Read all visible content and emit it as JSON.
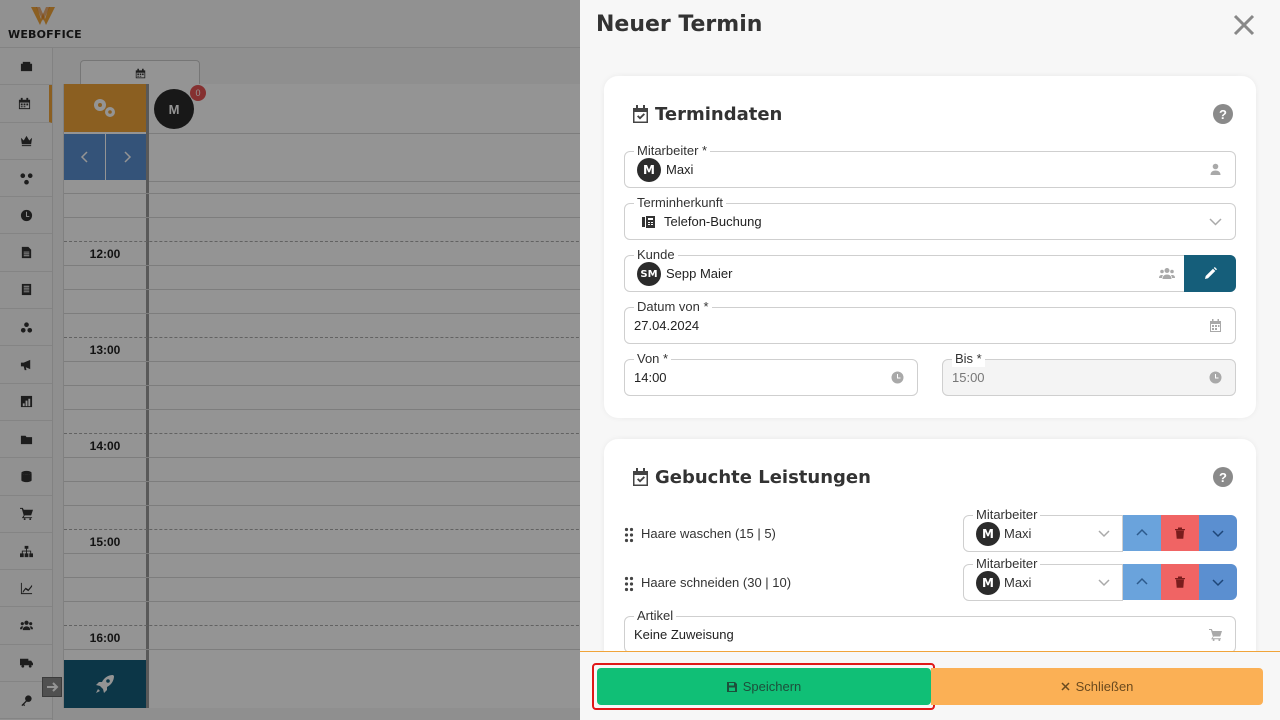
{
  "app": {
    "brand": "WEBOFFICE",
    "accent_color": "#f0a43a",
    "sidebar_icons": [
      "inbox-icon",
      "calendar-icon",
      "crown-icon",
      "network-icon",
      "clock-icon",
      "document-icon",
      "list-document-icon",
      "group-icon",
      "megaphone-icon",
      "chart-icon",
      "folder-icon",
      "database-icon",
      "cart-icon",
      "hierarchy-icon",
      "line-chart-icon",
      "users-icon",
      "truck-icon",
      "key-icon"
    ]
  },
  "calendar": {
    "staff_initial": "M",
    "staff_badge": "0",
    "times": [
      "12:00",
      "13:00",
      "14:00",
      "15:00",
      "16:00"
    ]
  },
  "modal": {
    "title": "Neuer Termin",
    "termindaten": {
      "heading": "Termindaten",
      "help": "?",
      "mitarbeiter": {
        "label": "Mitarbeiter *",
        "avatar": "M",
        "value": "Maxi"
      },
      "terminherkunft": {
        "label": "Terminherkunft",
        "value": "Telefon-Buchung"
      },
      "kunde": {
        "label": "Kunde",
        "avatar": "SM",
        "value": "Sepp Maier"
      },
      "datum_von": {
        "label": "Datum von *",
        "value": "27.04.2024"
      },
      "von": {
        "label": "Von *",
        "value": "14:00"
      },
      "bis": {
        "label": "Bis *",
        "value": "15:00"
      }
    },
    "leistungen": {
      "heading": "Gebuchte Leistungen",
      "help": "?",
      "services": [
        {
          "name": "Haare waschen (15 | 5)",
          "staff_label": "Mitarbeiter",
          "staff_avatar": "M",
          "staff": "Maxi"
        },
        {
          "name": "Haare schneiden (30 | 10)",
          "staff_label": "Mitarbeiter",
          "staff_avatar": "M",
          "staff": "Maxi"
        }
      ],
      "artikel": {
        "label": "Artikel",
        "value": "Keine Zuweisung"
      }
    },
    "footer": {
      "save_label": "Speichern",
      "close_label": "Schließen"
    }
  }
}
